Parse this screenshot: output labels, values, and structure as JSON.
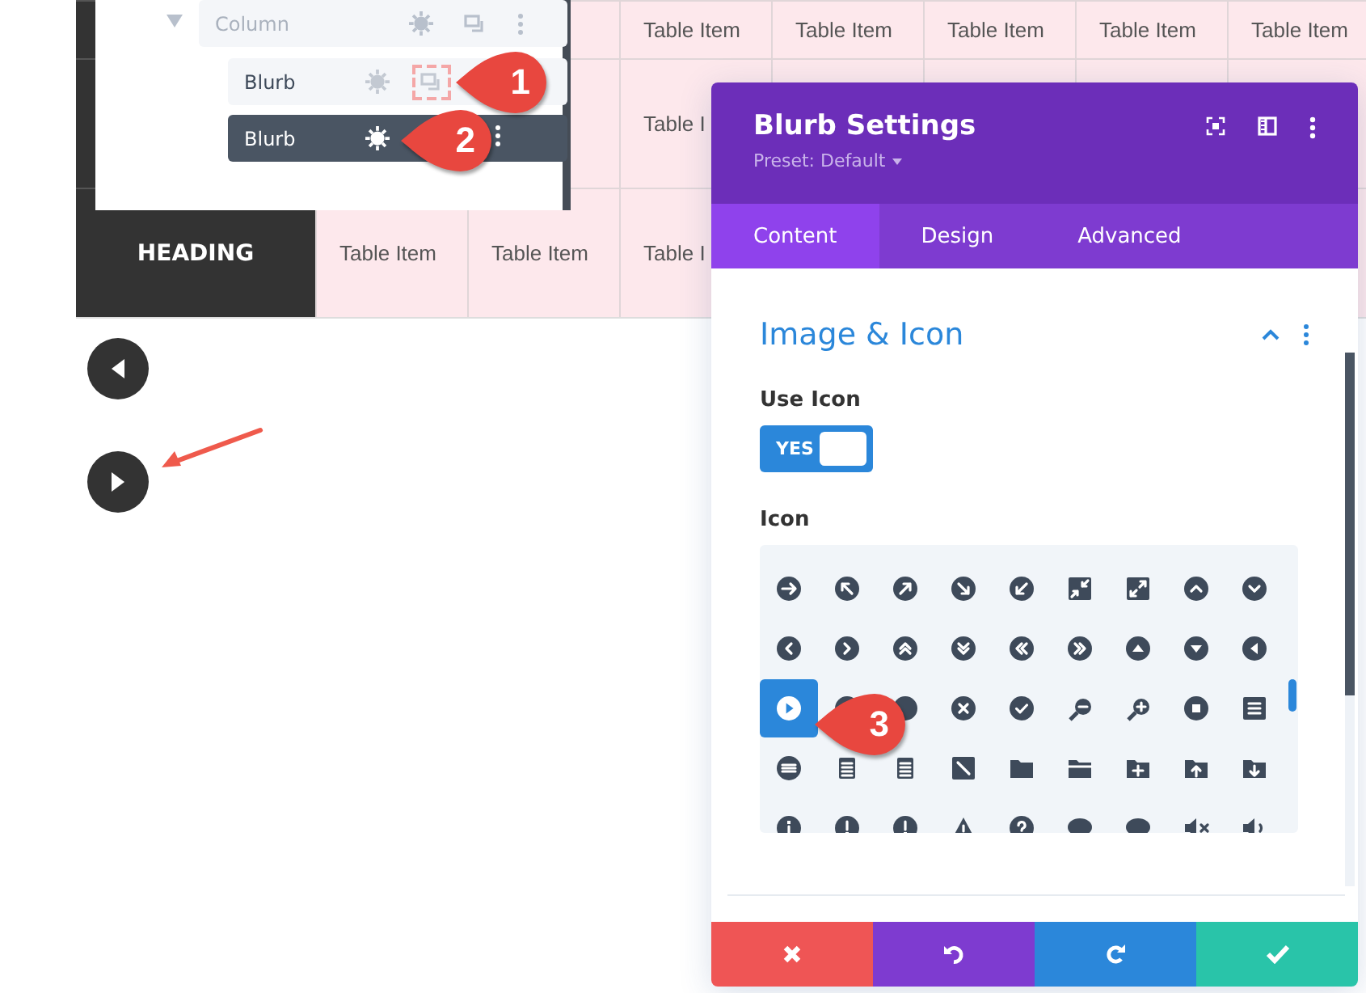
{
  "table": {
    "rows": [
      {
        "cells": [
          null,
          null,
          "Table Item",
          "Table Item",
          "Table Item",
          "Table Item",
          "Table Item"
        ]
      },
      {
        "cells": [
          null,
          null,
          "Table I",
          null,
          null,
          null,
          null
        ]
      },
      {
        "heading": "HEADING",
        "cells": [
          "Table Item",
          "Table Item",
          "Table I",
          null,
          null,
          null,
          null
        ]
      }
    ]
  },
  "layers": [
    {
      "label": "Column",
      "expanded": true,
      "children": [
        {
          "label": "Blurb",
          "selected": false,
          "highlighted": true
        },
        {
          "label": "Blurb",
          "selected": true,
          "highlighted": false
        }
      ]
    }
  ],
  "settings": {
    "title": "Blurb Settings",
    "preset": "Preset: Default",
    "tabs": [
      {
        "label": "Content",
        "selected": true
      },
      {
        "label": "Design",
        "selected": false
      },
      {
        "label": "Advanced",
        "selected": false
      }
    ],
    "section": {
      "title": "Image & Icon",
      "expanded": true
    },
    "use_icon": {
      "label": "Use Icon",
      "on": true,
      "value": "YES"
    },
    "icon_label": "Icon",
    "icons": [
      {
        "selected": false
      },
      {
        "selected": false
      },
      {
        "selected": false
      },
      {
        "selected": false
      },
      {
        "selected": false
      },
      {
        "selected": false
      },
      {
        "selected": false
      },
      {
        "selected": false
      },
      {
        "selected": false
      },
      {
        "selected": false
      },
      {
        "selected": false
      },
      {
        "selected": false
      },
      {
        "selected": false
      },
      {
        "selected": false
      },
      {
        "selected": false
      },
      {
        "selected": false
      },
      {
        "selected": false
      },
      {
        "selected": false
      },
      {
        "selected": true
      },
      {
        "selected": false
      },
      {
        "selected": false
      },
      {
        "selected": false
      },
      {
        "selected": false
      },
      {
        "selected": false
      },
      {
        "selected": false
      },
      {
        "selected": false
      },
      {
        "selected": false
      },
      {
        "selected": false
      },
      {
        "selected": false
      },
      {
        "selected": false
      },
      {
        "selected": false
      },
      {
        "selected": false
      },
      {
        "selected": false
      },
      {
        "selected": false
      },
      {
        "selected": false
      },
      {
        "selected": false
      },
      {
        "selected": false
      },
      {
        "selected": false
      },
      {
        "selected": false
      },
      {
        "selected": false
      },
      {
        "selected": false
      },
      {
        "selected": false
      },
      {
        "selected": false
      },
      {
        "selected": false
      },
      {
        "selected": false
      }
    ]
  },
  "callouts": [
    {
      "number": "1"
    },
    {
      "number": "2"
    },
    {
      "number": "3"
    }
  ]
}
